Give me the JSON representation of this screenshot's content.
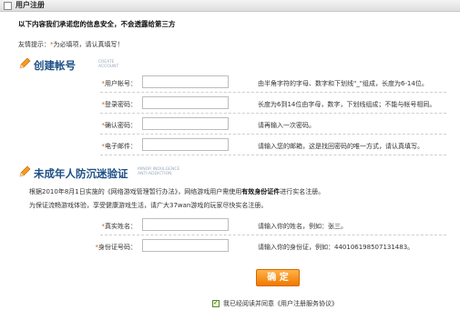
{
  "window": {
    "title": "用户注册"
  },
  "notice": "以下内容我们承诺您的信息安全，不会透露给第三方",
  "tip": {
    "prefix": "友情提示：",
    "star": "*",
    "text": "为必填项，请认真填写！"
  },
  "section1": {
    "title": "创建帐号",
    "subtitle_line1": "CREATE",
    "subtitle_line2": "ACCOUNT"
  },
  "fields": [
    {
      "star": "*",
      "label": "用户帐号：",
      "hint": "由半角字符的字母、数字和下划线\"_\"组成，长度为6-14位。"
    },
    {
      "star": "*",
      "label": "登录密码：",
      "hint": "长度为6到14位由字母，数字，下划线组成；不能与帐号相同。"
    },
    {
      "star": "*",
      "label": "确认密码：",
      "hint": "请再输入一次密码。"
    },
    {
      "star": "*",
      "label": "电子邮件：",
      "hint": "请输入您的邮箱，这是找回密码的唯一方式，请认真填写。"
    }
  ],
  "section2": {
    "title": "未成年人防沉迷验证",
    "subtitle_line1": "MINOR INDULGENCE",
    "subtitle_line2": "ANTI-ADDICTION"
  },
  "law_text": {
    "line1_a": "根据2010年8月1日实施的《网络游戏管理暂行办法》，网络游戏用户需使用",
    "line1_b": "有效身份证件",
    "line1_c": "进行实名注册。",
    "line2": "为保证流畅游戏体验，享受健康游戏生活，请广大37wan游戏的玩家尽快实名注册。"
  },
  "fields2": [
    {
      "star": "*",
      "label": "真实姓名：",
      "hint": "请输入你的姓名，例如：张三。"
    },
    {
      "star": "*",
      "label": "身份证号码：",
      "hint": "请输入你的身份证，例如：440106198507131483。"
    }
  ],
  "submit_label": "确 定",
  "agreement": {
    "checked": true,
    "text": "我已经阅读并同意《用户注册服务协议》"
  }
}
